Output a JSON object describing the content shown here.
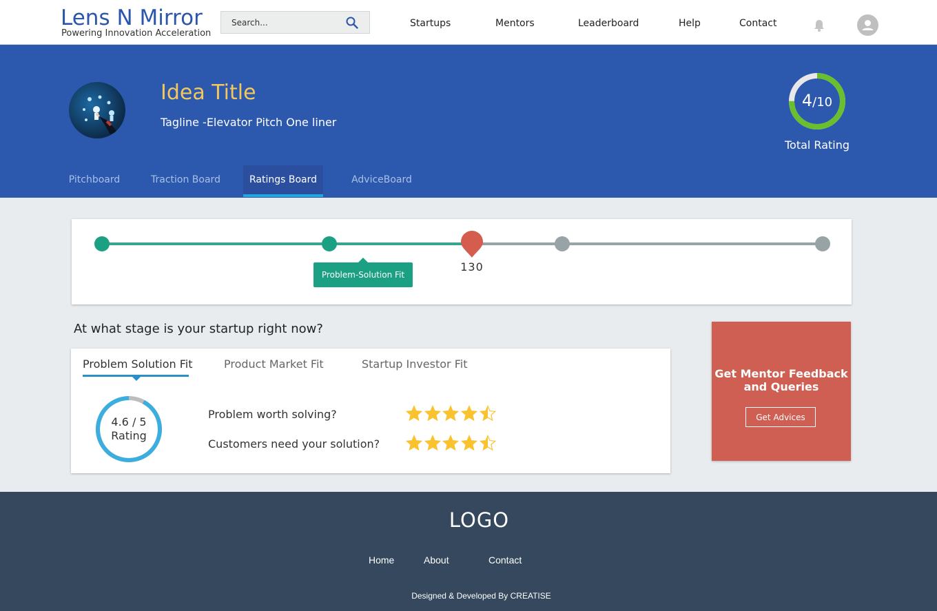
{
  "header": {
    "brand_title": "Lens N Mirror",
    "brand_subtitle": "Powering Innovation Acceleration",
    "search_placeholder": "Search...",
    "nav": [
      "Startups",
      "Mentors",
      "Leaderboard",
      "Help",
      "Contact"
    ]
  },
  "hero": {
    "idea_title": "Idea Title",
    "tagline": "Tagline  -Elevator Pitch One liner",
    "rating_value": "4",
    "rating_max": "/10",
    "rating_fraction": 0.4,
    "rating_label": "Total Rating",
    "tabs": [
      "Pitchboard",
      "Traction Board",
      "Ratings Board",
      "AdviceBoard"
    ],
    "active_tab": "Ratings Board"
  },
  "progress": {
    "current_step_label": "Problem-Solution Fit",
    "marker_value": "130",
    "completed_color": "#1ca084",
    "pending_color": "#98a3a6",
    "marker_color": "#d45d4d"
  },
  "stage": {
    "question": "At what stage is your startup right now?",
    "tabs": [
      "Problem Solution Fit",
      "Product Market Fit",
      "Startup Investor Fit"
    ],
    "active_tab": "Problem Solution Fit",
    "score": "4.6 / 5",
    "score_label": "Rating",
    "score_fraction": 0.92,
    "criteria": [
      {
        "label": "Problem worth solving?",
        "stars": 4.5
      },
      {
        "label": "Customers need your solution?",
        "stars": 4.5
      }
    ]
  },
  "mentor": {
    "title_line1": "Get Mentor Feedback",
    "title_line2": "and Queries",
    "button_label": "Get Advices"
  },
  "footer": {
    "logo": "LOGO",
    "links": [
      "Home",
      "About",
      "Contact"
    ],
    "credit": "Designed & Developed By CREATISE"
  },
  "colors": {
    "primary_blue": "#2c58ae",
    "accent_yellow": "#f4c75c",
    "ring_green": "#6abf2f",
    "mentor_red": "#cf5f53",
    "footer_dark": "#35485e",
    "star_gold": "#f9c22e"
  }
}
